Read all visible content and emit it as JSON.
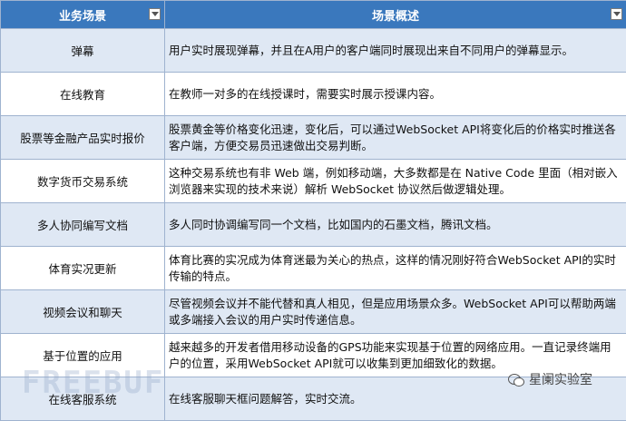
{
  "header": {
    "col1": "业务场景",
    "col2": "场景概述"
  },
  "rows": [
    {
      "scene": "弹幕",
      "desc": "用户实时展现弹幕，并且在A用户的客户端同时展现出来自不同用户的弹幕显示。"
    },
    {
      "scene": "在线教育",
      "desc": "在教师一对多的在线授课时，需要实时展示授课内容。"
    },
    {
      "scene": "股票等金融产品实时报价",
      "desc": "股票黄金等价格变化迅速，变化后，可以通过WebSocket API将变化后的价格实时推送各客户端，方便交易员迅速做出交易判断。"
    },
    {
      "scene": "数字货币交易系统",
      "desc": "这种交易系统也有非 Web 端，例如移动端，大多数都是在 Native Code 里面（相对嵌入浏览器来实现的技术来说）解析 WebSocket 协议然后做逻辑处理。"
    },
    {
      "scene": "多人协同编写文档",
      "desc": "多人同时协调编写同一个文档，比如国内的石墨文档，腾讯文档。"
    },
    {
      "scene": "体育实况更新",
      "desc": "体育比赛的实况成为体育迷最为关心的热点，这样的情况刚好符合WebSocket API的实时传输的特点。"
    },
    {
      "scene": "视频会议和聊天",
      "desc": "尽管视频会议并不能代替和真人相见，但是应用场景众多。WebSocket API可以帮助两端或多端接入会议的用户实时传递信息。"
    },
    {
      "scene": "基于位置的应用",
      "desc": "越来越多的开发者借用移动设备的GPS功能来实现基于位置的网络应用。一直记录终端用户的位置，采用WebSocket API就可以收集到更加细致化的数据。"
    },
    {
      "scene": "在线客服系统",
      "desc": "在线客服聊天框问题解答，实时交流。"
    }
  ],
  "watermark": {
    "left": "FREEBUF",
    "right": "星阑实验室"
  },
  "icons": {
    "filter": "filter-dropdown-icon",
    "wechat": "wechat-icon"
  }
}
